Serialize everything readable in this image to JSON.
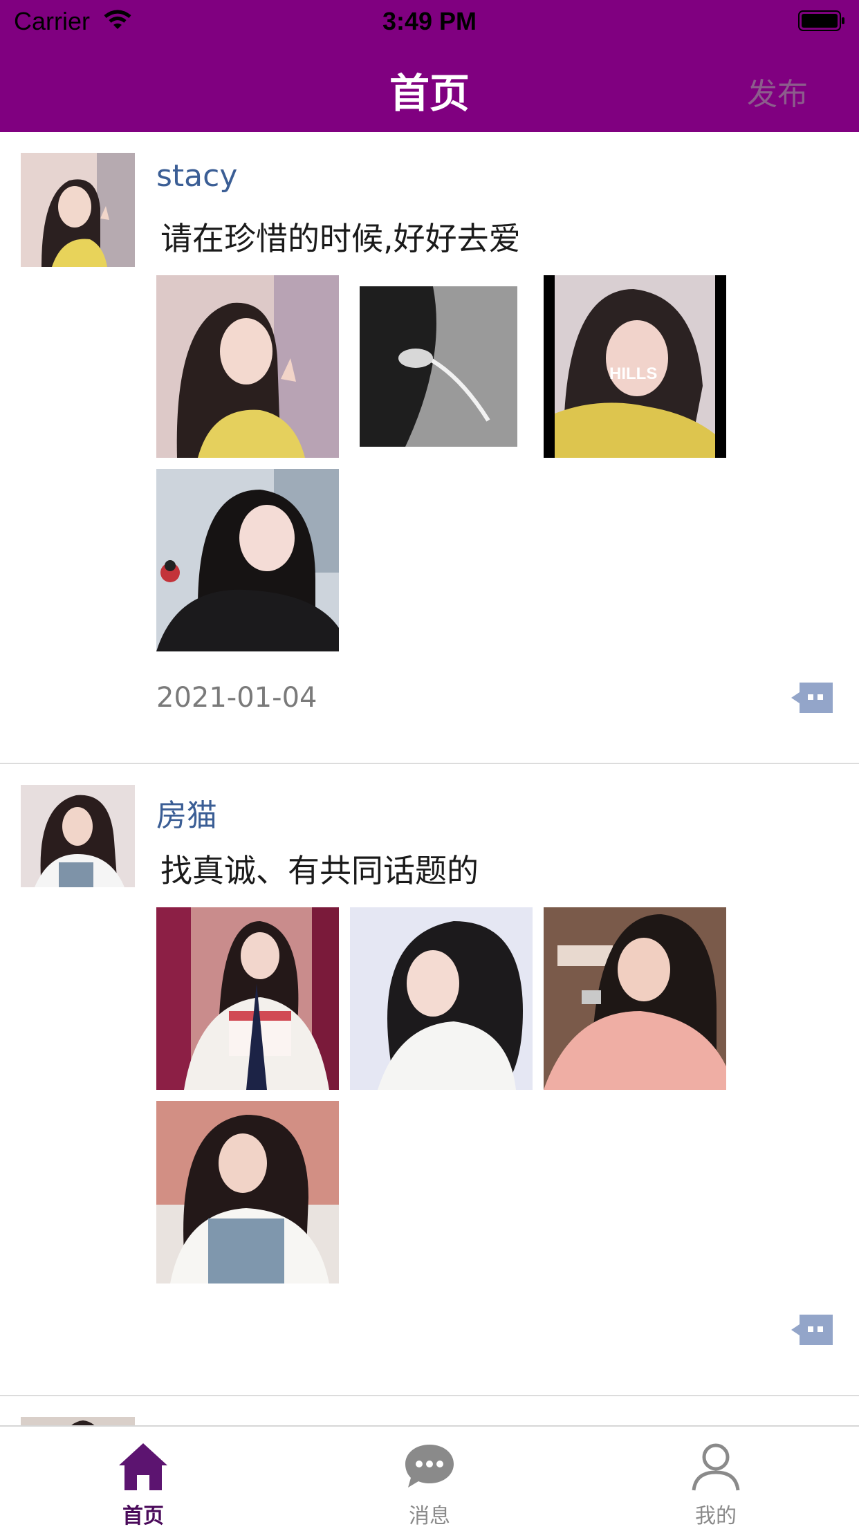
{
  "status_bar": {
    "carrier": "Carrier",
    "time": "3:49 PM"
  },
  "nav": {
    "title": "首页",
    "action_label": "发布"
  },
  "colors": {
    "nav_bg": "#800080",
    "username": "#3b5e95",
    "tab_active": "#4a0a5a",
    "tab_inactive": "#8a8a8a",
    "comment_icon": "#93a5c9"
  },
  "posts": [
    {
      "username": "stacy",
      "text": "请在珍惜的时候,好好去爱",
      "date": "2021-01-04",
      "photo_count": 4
    },
    {
      "username": "房猫",
      "text": "找真诚、有共同话题的",
      "date": "",
      "photo_count": 4
    }
  ],
  "tabbar": {
    "items": [
      {
        "label": "首页",
        "icon": "home-icon",
        "active": true
      },
      {
        "label": "消息",
        "icon": "chat-icon",
        "active": false
      },
      {
        "label": "我的",
        "icon": "user-icon",
        "active": false
      }
    ]
  }
}
